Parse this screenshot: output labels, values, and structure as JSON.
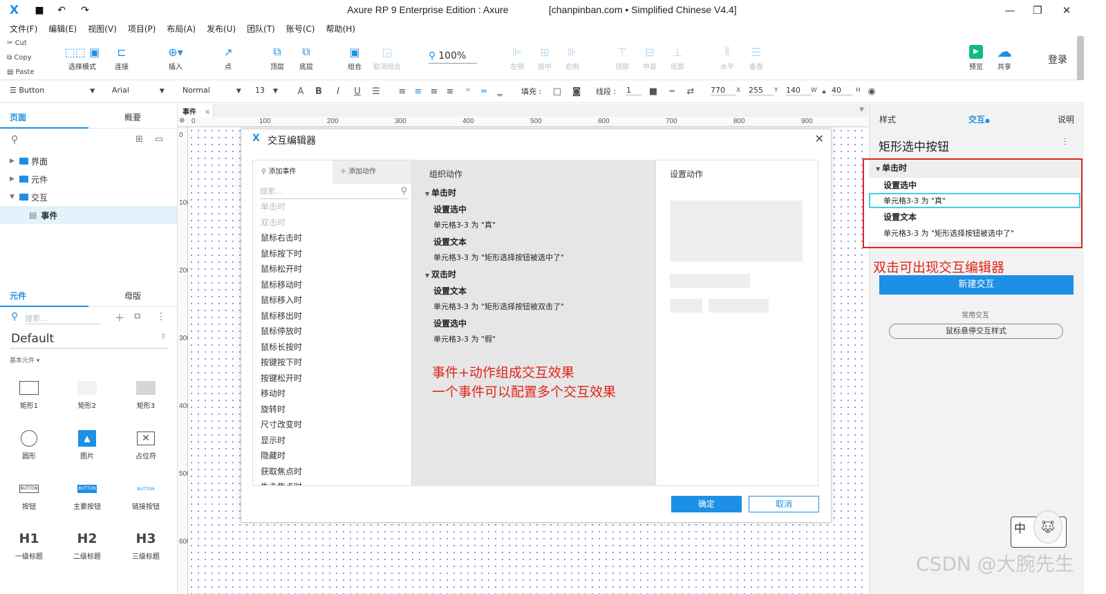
{
  "title": {
    "app": "Axure RP 9 Enterprise Edition : Axure",
    "site": "[chanpinban.com • Simplified Chinese V4.4]"
  },
  "menu": [
    "文件(F)",
    "编辑(E)",
    "视图(V)",
    "项目(P)",
    "布局(A)",
    "发布(U)",
    "团队(T)",
    "账号(C)",
    "帮助(H)"
  ],
  "clipboard": {
    "cut": "Cut",
    "copy": "Copy",
    "paste": "Paste"
  },
  "toolbar": {
    "select_mode": "选择模式",
    "connect": "连接",
    "insert": "插入",
    "point": "点",
    "top": "顶层",
    "bottom": "底层",
    "group": "组合",
    "ungroup": "取消组合",
    "zoom": "100%",
    "align": [
      "左侧",
      "居中",
      "右侧",
      "顶部",
      "中部",
      "底部"
    ],
    "distribute": [
      "水平",
      "垂直"
    ],
    "preview": "预览",
    "share": "共享",
    "login": "登录"
  },
  "format": {
    "widget_type": "Button",
    "font": "Arial",
    "style": "Normal",
    "size": "13",
    "fill_label": "填充 :",
    "line_label": "线段 :",
    "line_value": "1",
    "x": "770",
    "x_label": "X",
    "y": "255",
    "y_label": "Y",
    "w": "140",
    "w_label": "W",
    "h": "40",
    "h_label": "H"
  },
  "pages_panel": {
    "tabs": [
      "页面",
      "概要"
    ],
    "tree": [
      {
        "label": "界面",
        "expanded": false
      },
      {
        "label": "元件",
        "expanded": false
      },
      {
        "label": "交互",
        "expanded": true
      },
      {
        "label": "事件",
        "selected": true
      }
    ]
  },
  "library_panel": {
    "tabs": [
      "元件",
      "母版"
    ],
    "search_placeholder": "搜索...",
    "library": "Default",
    "category": "基本元件 ▾",
    "widgets": [
      {
        "label": "矩形1"
      },
      {
        "label": "矩形2"
      },
      {
        "label": "矩形3"
      },
      {
        "label": "圆形"
      },
      {
        "label": "图片"
      },
      {
        "label": "占位符"
      },
      {
        "label": "按钮",
        "text": "BUTTON"
      },
      {
        "label": "主要按钮",
        "text": "BUTTON"
      },
      {
        "label": "链接按钮",
        "text": "BUTTON"
      },
      {
        "label": "一级标题",
        "text": "H1"
      },
      {
        "label": "二级标题",
        "text": "H2"
      },
      {
        "label": "三级标题",
        "text": "H3"
      }
    ]
  },
  "canvas": {
    "tab": "事件",
    "ruler_h": [
      "0",
      "100",
      "200",
      "300",
      "400",
      "500",
      "600",
      "700",
      "800",
      "900"
    ],
    "ruler_v": [
      "0",
      "100",
      "200",
      "300",
      "400",
      "500",
      "600"
    ]
  },
  "dialog": {
    "title": "交互编辑器",
    "tab_add_event": "添加事件",
    "tab_add_action": "添加动作",
    "search_placeholder": "搜索...",
    "events": [
      {
        "label": "单击时",
        "disabled": true
      },
      {
        "label": "双击时",
        "disabled": true
      },
      {
        "label": "鼠标右击时"
      },
      {
        "label": "鼠标按下时"
      },
      {
        "label": "鼠标松开时"
      },
      {
        "label": "鼠标移动时"
      },
      {
        "label": "鼠标移入时"
      },
      {
        "label": "鼠标移出时"
      },
      {
        "label": "鼠标停放时"
      },
      {
        "label": "鼠标长按时"
      },
      {
        "label": "按键按下时"
      },
      {
        "label": "按键松开时"
      },
      {
        "label": "移动时"
      },
      {
        "label": "旋转时"
      },
      {
        "label": "尺寸改变时"
      },
      {
        "label": "显示时"
      },
      {
        "label": "隐藏时"
      },
      {
        "label": "获取焦点时"
      },
      {
        "label": "失去焦点时"
      }
    ],
    "organize_header": "组织动作",
    "groups": [
      {
        "event": "单击时",
        "actions": [
          {
            "name": "设置选中",
            "detail": "单元格3-3 为 \"真\""
          },
          {
            "name": "设置文本",
            "detail": "单元格3-3 为 \"矩形选择按钮被选中了\""
          }
        ]
      },
      {
        "event": "双击时",
        "actions": [
          {
            "name": "设置文本",
            "detail": "单元格3-3 为 \"矩形选择按钮被双击了\""
          },
          {
            "name": "设置选中",
            "detail": "单元格3-3 为 \"假\""
          }
        ]
      }
    ],
    "note_lines": [
      "事件+动作组成交互效果",
      "一个事件可以配置多个交互效果"
    ],
    "settings_header": "设置动作",
    "ok": "确定",
    "cancel": "取消"
  },
  "right_panel": {
    "tabs": [
      "样式",
      "交互",
      "说明"
    ],
    "widget_name": "矩形选中按钮",
    "event": "单击时",
    "actions": [
      {
        "name": "设置选中",
        "detail": "单元格3-3 为 \"真\""
      },
      {
        "name": "设置文本",
        "detail": "单元格3-3 为 \"矩形选择按钮被选中了\""
      }
    ],
    "note": "双击可出现交互编辑器",
    "new_interaction": "新建交互",
    "common": "常用交互",
    "hover_style": "鼠标悬停交互样式"
  },
  "ime": {
    "label": "中"
  },
  "watermark": "CSDN @大腕先生",
  "colors": {
    "accent": "#1e8fe6",
    "annotation": "#e0231a"
  }
}
